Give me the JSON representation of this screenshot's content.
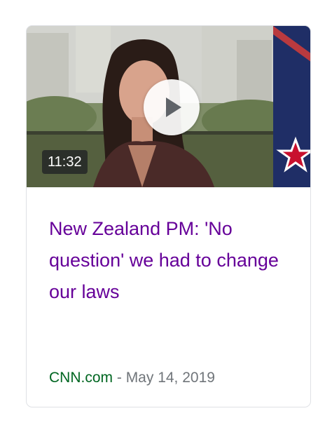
{
  "video": {
    "duration": "11:32",
    "title": "New Zealand PM: 'No question' we had to change our laws",
    "source": "CNN.com",
    "separator": " - ",
    "date": "May 14, 2019"
  },
  "icons": {
    "play": "play-icon"
  },
  "colors": {
    "title_visited": "#660099",
    "source_green": "#006621",
    "date_gray": "#70757a",
    "card_border": "#dfe1e5"
  }
}
